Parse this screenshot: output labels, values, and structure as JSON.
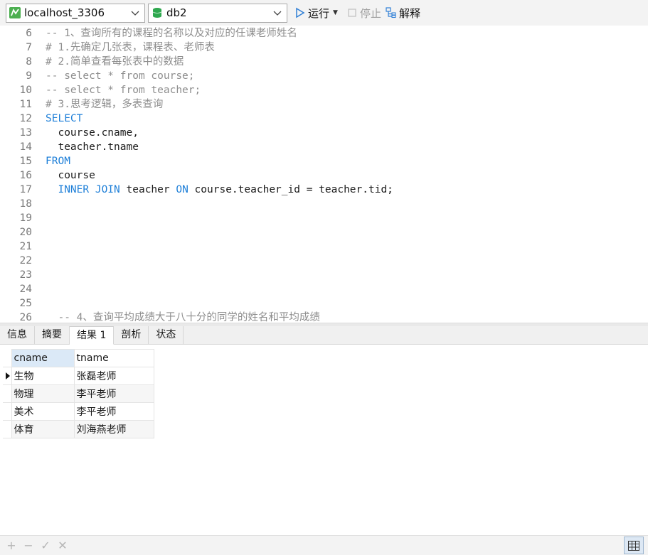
{
  "toolbar": {
    "connection": "localhost_3306",
    "database": "db2",
    "run_label": "运行",
    "stop_label": "停止",
    "explain_label": "解释",
    "colors": {
      "connection_icon": "#4caf50",
      "db_icon": "#2fa84f",
      "run_icon": "#2f7fd6"
    }
  },
  "editor": {
    "lines": [
      {
        "num": "6",
        "tokens": [
          {
            "t": "comment",
            "v": "-- 1、查询所有的课程的名称以及对应的任课老师姓名"
          }
        ]
      },
      {
        "num": "7",
        "tokens": [
          {
            "t": "comment",
            "v": "# 1.先确定几张表，课程表、老师表"
          }
        ]
      },
      {
        "num": "8",
        "tokens": [
          {
            "t": "comment",
            "v": "# 2.简单查看每张表中的数据"
          }
        ]
      },
      {
        "num": "9",
        "tokens": [
          {
            "t": "comment",
            "v": "-- select * from course;"
          }
        ]
      },
      {
        "num": "10",
        "tokens": [
          {
            "t": "comment",
            "v": "-- select * from teacher;"
          }
        ]
      },
      {
        "num": "11",
        "tokens": [
          {
            "t": "comment",
            "v": "# 3.思考逻辑，多表查询"
          }
        ]
      },
      {
        "num": "12",
        "tokens": [
          {
            "t": "keyword",
            "v": "SELECT"
          }
        ]
      },
      {
        "num": "13",
        "tokens": [
          {
            "t": "plain",
            "v": "  course.cname,"
          }
        ]
      },
      {
        "num": "14",
        "tokens": [
          {
            "t": "plain",
            "v": "  teacher.tname"
          }
        ]
      },
      {
        "num": "15",
        "tokens": [
          {
            "t": "keyword",
            "v": "FROM"
          }
        ]
      },
      {
        "num": "16",
        "tokens": [
          {
            "t": "plain",
            "v": "  course"
          }
        ]
      },
      {
        "num": "17",
        "tokens": [
          {
            "t": "plain",
            "v": "  "
          },
          {
            "t": "keyword",
            "v": "INNER JOIN"
          },
          {
            "t": "plain",
            "v": " teacher "
          },
          {
            "t": "keyword",
            "v": "ON"
          },
          {
            "t": "plain",
            "v": " course.teacher_id = teacher.tid;"
          }
        ]
      },
      {
        "num": "18",
        "tokens": []
      },
      {
        "num": "19",
        "tokens": []
      },
      {
        "num": "20",
        "tokens": []
      },
      {
        "num": "21",
        "tokens": []
      },
      {
        "num": "22",
        "tokens": []
      },
      {
        "num": "23",
        "tokens": []
      },
      {
        "num": "24",
        "tokens": []
      },
      {
        "num": "25",
        "tokens": []
      },
      {
        "num": "26",
        "tokens": [
          {
            "t": "comment",
            "v": "  -- 4、查询平均成绩大于八十分的同学的姓名和平均成绩"
          }
        ]
      }
    ]
  },
  "tabs": [
    {
      "label": "信息",
      "active": false
    },
    {
      "label": "摘要",
      "active": false
    },
    {
      "label": "结果 1",
      "active": true
    },
    {
      "label": "剖析",
      "active": false
    },
    {
      "label": "状态",
      "active": false
    }
  ],
  "results": {
    "columns": [
      "cname",
      "tname"
    ],
    "rows": [
      [
        "生物",
        "张磊老师"
      ],
      [
        "物理",
        "李平老师"
      ],
      [
        "美术",
        "李平老师"
      ],
      [
        "体育",
        "刘海燕老师"
      ]
    ]
  },
  "bottombar": {
    "add": "+",
    "remove": "−",
    "apply": "✓",
    "discard": "✕"
  }
}
